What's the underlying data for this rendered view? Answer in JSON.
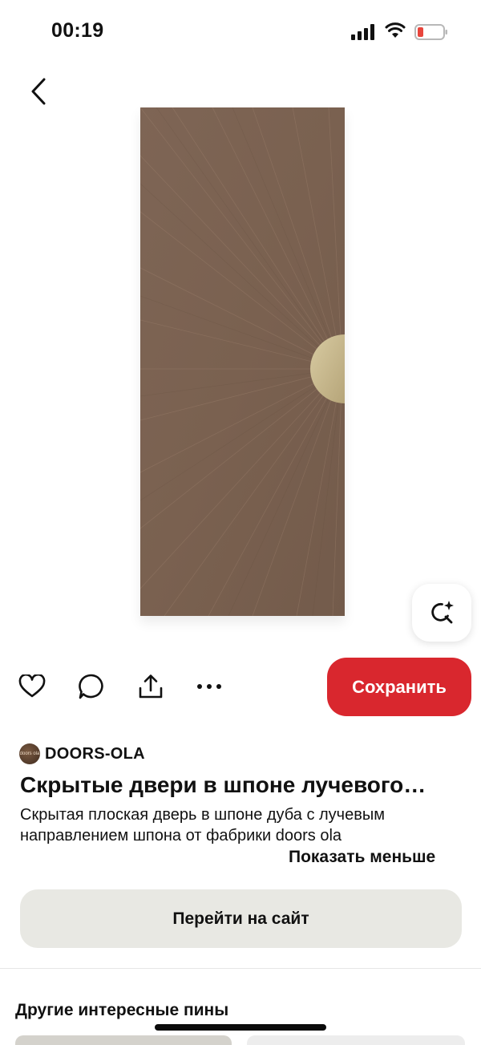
{
  "status_bar": {
    "time": "00:19",
    "signal_icon": "cellular-signal-icon",
    "wifi_icon": "wifi-icon",
    "battery_icon": "battery-low-icon",
    "battery_color": "#e8453c"
  },
  "nav": {
    "back_icon": "chevron-left-icon"
  },
  "pin": {
    "image_description_icon": "door-image",
    "visual_search_icon": "visual-search-sparkle-icon"
  },
  "actions": {
    "like_icon": "heart-icon",
    "comment_icon": "comment-bubble-icon",
    "share_icon": "share-upload-icon",
    "more_icon": "more-dots-icon",
    "save_label": "Сохранить"
  },
  "creator": {
    "name": "DOORS-OLA",
    "avatar_text": "doors ola"
  },
  "details": {
    "title": "Скрытые двери в шпоне лучевого…",
    "description": "Скрытая плоская дверь в шпоне дуба с лучевым направлением шпона от фабрики doors ola",
    "show_less": "Показать меньше"
  },
  "visit": {
    "label": "Перейти на сайт"
  },
  "more_pins": {
    "heading": "Другие интересные пины"
  },
  "colors": {
    "accent_red": "#d9272e",
    "secondary_button": "#e8e8e3",
    "veneer": "#7b6352",
    "handle_brass": "#c9b98e"
  }
}
